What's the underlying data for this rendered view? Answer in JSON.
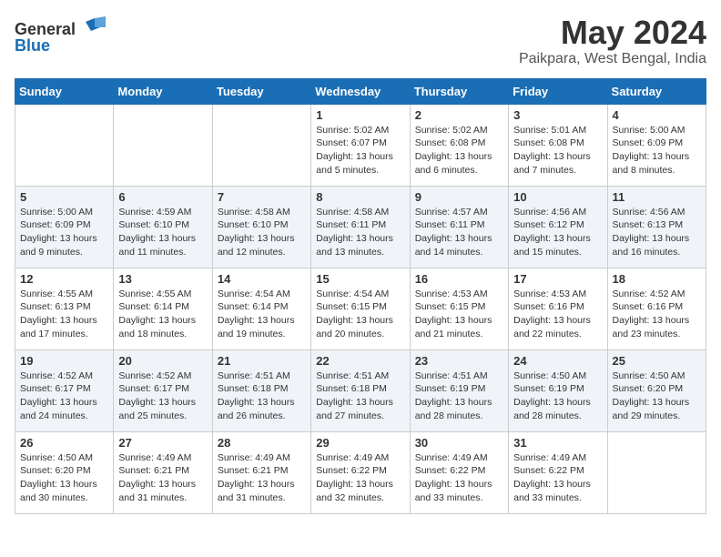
{
  "header": {
    "logo_general": "General",
    "logo_blue": "Blue",
    "month_title": "May 2024",
    "location": "Paikpara, West Bengal, India"
  },
  "days_of_week": [
    "Sunday",
    "Monday",
    "Tuesday",
    "Wednesday",
    "Thursday",
    "Friday",
    "Saturday"
  ],
  "weeks": [
    [
      {
        "day": "",
        "info": ""
      },
      {
        "day": "",
        "info": ""
      },
      {
        "day": "",
        "info": ""
      },
      {
        "day": "1",
        "info": "Sunrise: 5:02 AM\nSunset: 6:07 PM\nDaylight: 13 hours\nand 5 minutes."
      },
      {
        "day": "2",
        "info": "Sunrise: 5:02 AM\nSunset: 6:08 PM\nDaylight: 13 hours\nand 6 minutes."
      },
      {
        "day": "3",
        "info": "Sunrise: 5:01 AM\nSunset: 6:08 PM\nDaylight: 13 hours\nand 7 minutes."
      },
      {
        "day": "4",
        "info": "Sunrise: 5:00 AM\nSunset: 6:09 PM\nDaylight: 13 hours\nand 8 minutes."
      }
    ],
    [
      {
        "day": "5",
        "info": "Sunrise: 5:00 AM\nSunset: 6:09 PM\nDaylight: 13 hours\nand 9 minutes."
      },
      {
        "day": "6",
        "info": "Sunrise: 4:59 AM\nSunset: 6:10 PM\nDaylight: 13 hours\nand 11 minutes."
      },
      {
        "day": "7",
        "info": "Sunrise: 4:58 AM\nSunset: 6:10 PM\nDaylight: 13 hours\nand 12 minutes."
      },
      {
        "day": "8",
        "info": "Sunrise: 4:58 AM\nSunset: 6:11 PM\nDaylight: 13 hours\nand 13 minutes."
      },
      {
        "day": "9",
        "info": "Sunrise: 4:57 AM\nSunset: 6:11 PM\nDaylight: 13 hours\nand 14 minutes."
      },
      {
        "day": "10",
        "info": "Sunrise: 4:56 AM\nSunset: 6:12 PM\nDaylight: 13 hours\nand 15 minutes."
      },
      {
        "day": "11",
        "info": "Sunrise: 4:56 AM\nSunset: 6:13 PM\nDaylight: 13 hours\nand 16 minutes."
      }
    ],
    [
      {
        "day": "12",
        "info": "Sunrise: 4:55 AM\nSunset: 6:13 PM\nDaylight: 13 hours\nand 17 minutes."
      },
      {
        "day": "13",
        "info": "Sunrise: 4:55 AM\nSunset: 6:14 PM\nDaylight: 13 hours\nand 18 minutes."
      },
      {
        "day": "14",
        "info": "Sunrise: 4:54 AM\nSunset: 6:14 PM\nDaylight: 13 hours\nand 19 minutes."
      },
      {
        "day": "15",
        "info": "Sunrise: 4:54 AM\nSunset: 6:15 PM\nDaylight: 13 hours\nand 20 minutes."
      },
      {
        "day": "16",
        "info": "Sunrise: 4:53 AM\nSunset: 6:15 PM\nDaylight: 13 hours\nand 21 minutes."
      },
      {
        "day": "17",
        "info": "Sunrise: 4:53 AM\nSunset: 6:16 PM\nDaylight: 13 hours\nand 22 minutes."
      },
      {
        "day": "18",
        "info": "Sunrise: 4:52 AM\nSunset: 6:16 PM\nDaylight: 13 hours\nand 23 minutes."
      }
    ],
    [
      {
        "day": "19",
        "info": "Sunrise: 4:52 AM\nSunset: 6:17 PM\nDaylight: 13 hours\nand 24 minutes."
      },
      {
        "day": "20",
        "info": "Sunrise: 4:52 AM\nSunset: 6:17 PM\nDaylight: 13 hours\nand 25 minutes."
      },
      {
        "day": "21",
        "info": "Sunrise: 4:51 AM\nSunset: 6:18 PM\nDaylight: 13 hours\nand 26 minutes."
      },
      {
        "day": "22",
        "info": "Sunrise: 4:51 AM\nSunset: 6:18 PM\nDaylight: 13 hours\nand 27 minutes."
      },
      {
        "day": "23",
        "info": "Sunrise: 4:51 AM\nSunset: 6:19 PM\nDaylight: 13 hours\nand 28 minutes."
      },
      {
        "day": "24",
        "info": "Sunrise: 4:50 AM\nSunset: 6:19 PM\nDaylight: 13 hours\nand 28 minutes."
      },
      {
        "day": "25",
        "info": "Sunrise: 4:50 AM\nSunset: 6:20 PM\nDaylight: 13 hours\nand 29 minutes."
      }
    ],
    [
      {
        "day": "26",
        "info": "Sunrise: 4:50 AM\nSunset: 6:20 PM\nDaylight: 13 hours\nand 30 minutes."
      },
      {
        "day": "27",
        "info": "Sunrise: 4:49 AM\nSunset: 6:21 PM\nDaylight: 13 hours\nand 31 minutes."
      },
      {
        "day": "28",
        "info": "Sunrise: 4:49 AM\nSunset: 6:21 PM\nDaylight: 13 hours\nand 31 minutes."
      },
      {
        "day": "29",
        "info": "Sunrise: 4:49 AM\nSunset: 6:22 PM\nDaylight: 13 hours\nand 32 minutes."
      },
      {
        "day": "30",
        "info": "Sunrise: 4:49 AM\nSunset: 6:22 PM\nDaylight: 13 hours\nand 33 minutes."
      },
      {
        "day": "31",
        "info": "Sunrise: 4:49 AM\nSunset: 6:22 PM\nDaylight: 13 hours\nand 33 minutes."
      },
      {
        "day": "",
        "info": ""
      }
    ]
  ]
}
